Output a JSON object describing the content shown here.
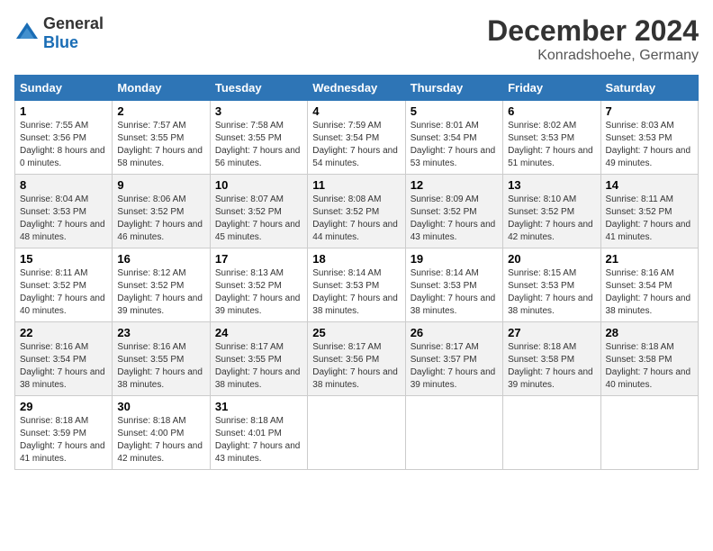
{
  "logo": {
    "general": "General",
    "blue": "Blue"
  },
  "title": "December 2024",
  "subtitle": "Konradshoehe, Germany",
  "days_of_week": [
    "Sunday",
    "Monday",
    "Tuesday",
    "Wednesday",
    "Thursday",
    "Friday",
    "Saturday"
  ],
  "weeks": [
    [
      {
        "day": "1",
        "sunrise": "Sunrise: 7:55 AM",
        "sunset": "Sunset: 3:56 PM",
        "daylight": "Daylight: 8 hours and 0 minutes."
      },
      {
        "day": "2",
        "sunrise": "Sunrise: 7:57 AM",
        "sunset": "Sunset: 3:55 PM",
        "daylight": "Daylight: 7 hours and 58 minutes."
      },
      {
        "day": "3",
        "sunrise": "Sunrise: 7:58 AM",
        "sunset": "Sunset: 3:55 PM",
        "daylight": "Daylight: 7 hours and 56 minutes."
      },
      {
        "day": "4",
        "sunrise": "Sunrise: 7:59 AM",
        "sunset": "Sunset: 3:54 PM",
        "daylight": "Daylight: 7 hours and 54 minutes."
      },
      {
        "day": "5",
        "sunrise": "Sunrise: 8:01 AM",
        "sunset": "Sunset: 3:54 PM",
        "daylight": "Daylight: 7 hours and 53 minutes."
      },
      {
        "day": "6",
        "sunrise": "Sunrise: 8:02 AM",
        "sunset": "Sunset: 3:53 PM",
        "daylight": "Daylight: 7 hours and 51 minutes."
      },
      {
        "day": "7",
        "sunrise": "Sunrise: 8:03 AM",
        "sunset": "Sunset: 3:53 PM",
        "daylight": "Daylight: 7 hours and 49 minutes."
      }
    ],
    [
      {
        "day": "8",
        "sunrise": "Sunrise: 8:04 AM",
        "sunset": "Sunset: 3:53 PM",
        "daylight": "Daylight: 7 hours and 48 minutes."
      },
      {
        "day": "9",
        "sunrise": "Sunrise: 8:06 AM",
        "sunset": "Sunset: 3:52 PM",
        "daylight": "Daylight: 7 hours and 46 minutes."
      },
      {
        "day": "10",
        "sunrise": "Sunrise: 8:07 AM",
        "sunset": "Sunset: 3:52 PM",
        "daylight": "Daylight: 7 hours and 45 minutes."
      },
      {
        "day": "11",
        "sunrise": "Sunrise: 8:08 AM",
        "sunset": "Sunset: 3:52 PM",
        "daylight": "Daylight: 7 hours and 44 minutes."
      },
      {
        "day": "12",
        "sunrise": "Sunrise: 8:09 AM",
        "sunset": "Sunset: 3:52 PM",
        "daylight": "Daylight: 7 hours and 43 minutes."
      },
      {
        "day": "13",
        "sunrise": "Sunrise: 8:10 AM",
        "sunset": "Sunset: 3:52 PM",
        "daylight": "Daylight: 7 hours and 42 minutes."
      },
      {
        "day": "14",
        "sunrise": "Sunrise: 8:11 AM",
        "sunset": "Sunset: 3:52 PM",
        "daylight": "Daylight: 7 hours and 41 minutes."
      }
    ],
    [
      {
        "day": "15",
        "sunrise": "Sunrise: 8:11 AM",
        "sunset": "Sunset: 3:52 PM",
        "daylight": "Daylight: 7 hours and 40 minutes."
      },
      {
        "day": "16",
        "sunrise": "Sunrise: 8:12 AM",
        "sunset": "Sunset: 3:52 PM",
        "daylight": "Daylight: 7 hours and 39 minutes."
      },
      {
        "day": "17",
        "sunrise": "Sunrise: 8:13 AM",
        "sunset": "Sunset: 3:52 PM",
        "daylight": "Daylight: 7 hours and 39 minutes."
      },
      {
        "day": "18",
        "sunrise": "Sunrise: 8:14 AM",
        "sunset": "Sunset: 3:53 PM",
        "daylight": "Daylight: 7 hours and 38 minutes."
      },
      {
        "day": "19",
        "sunrise": "Sunrise: 8:14 AM",
        "sunset": "Sunset: 3:53 PM",
        "daylight": "Daylight: 7 hours and 38 minutes."
      },
      {
        "day": "20",
        "sunrise": "Sunrise: 8:15 AM",
        "sunset": "Sunset: 3:53 PM",
        "daylight": "Daylight: 7 hours and 38 minutes."
      },
      {
        "day": "21",
        "sunrise": "Sunrise: 8:16 AM",
        "sunset": "Sunset: 3:54 PM",
        "daylight": "Daylight: 7 hours and 38 minutes."
      }
    ],
    [
      {
        "day": "22",
        "sunrise": "Sunrise: 8:16 AM",
        "sunset": "Sunset: 3:54 PM",
        "daylight": "Daylight: 7 hours and 38 minutes."
      },
      {
        "day": "23",
        "sunrise": "Sunrise: 8:16 AM",
        "sunset": "Sunset: 3:55 PM",
        "daylight": "Daylight: 7 hours and 38 minutes."
      },
      {
        "day": "24",
        "sunrise": "Sunrise: 8:17 AM",
        "sunset": "Sunset: 3:55 PM",
        "daylight": "Daylight: 7 hours and 38 minutes."
      },
      {
        "day": "25",
        "sunrise": "Sunrise: 8:17 AM",
        "sunset": "Sunset: 3:56 PM",
        "daylight": "Daylight: 7 hours and 38 minutes."
      },
      {
        "day": "26",
        "sunrise": "Sunrise: 8:17 AM",
        "sunset": "Sunset: 3:57 PM",
        "daylight": "Daylight: 7 hours and 39 minutes."
      },
      {
        "day": "27",
        "sunrise": "Sunrise: 8:18 AM",
        "sunset": "Sunset: 3:58 PM",
        "daylight": "Daylight: 7 hours and 39 minutes."
      },
      {
        "day": "28",
        "sunrise": "Sunrise: 8:18 AM",
        "sunset": "Sunset: 3:58 PM",
        "daylight": "Daylight: 7 hours and 40 minutes."
      }
    ],
    [
      {
        "day": "29",
        "sunrise": "Sunrise: 8:18 AM",
        "sunset": "Sunset: 3:59 PM",
        "daylight": "Daylight: 7 hours and 41 minutes."
      },
      {
        "day": "30",
        "sunrise": "Sunrise: 8:18 AM",
        "sunset": "Sunset: 4:00 PM",
        "daylight": "Daylight: 7 hours and 42 minutes."
      },
      {
        "day": "31",
        "sunrise": "Sunrise: 8:18 AM",
        "sunset": "Sunset: 4:01 PM",
        "daylight": "Daylight: 7 hours and 43 minutes."
      },
      null,
      null,
      null,
      null
    ]
  ]
}
